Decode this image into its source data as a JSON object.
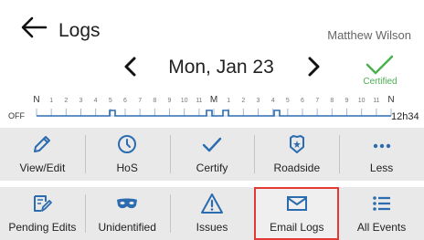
{
  "header": {
    "title": "Logs",
    "driver": "Matthew Wilson"
  },
  "date_nav": {
    "date": "Mon, Jan 23",
    "certified_label": "Certified"
  },
  "graph": {
    "hour_labels": [
      "N",
      "1",
      "2",
      "3",
      "4",
      "5",
      "6",
      "7",
      "8",
      "9",
      "10",
      "11",
      "M",
      "1",
      "2",
      "3",
      "4",
      "5",
      "6",
      "7",
      "8",
      "9",
      "10",
      "11",
      "N"
    ],
    "status_label": "OFF",
    "total": "12h34"
  },
  "actions_row1": [
    {
      "label": "View/Edit",
      "icon": "pencil-icon"
    },
    {
      "label": "HoS",
      "icon": "clock-icon"
    },
    {
      "label": "Certify",
      "icon": "checkmark-icon"
    },
    {
      "label": "Roadside",
      "icon": "badge-icon"
    },
    {
      "label": "Less",
      "icon": "ellipsis-icon"
    }
  ],
  "actions_row2": [
    {
      "label": "Pending Edits",
      "icon": "edit-document-icon"
    },
    {
      "label": "Unidentified",
      "icon": "mask-icon"
    },
    {
      "label": "Issues",
      "icon": "warning-icon"
    },
    {
      "label": "Email Logs",
      "icon": "mail-icon"
    },
    {
      "label": "All Events",
      "icon": "list-icon"
    }
  ],
  "colors": {
    "accent": "#2b6cb0",
    "certified": "#4caf50",
    "highlight": "#e53935",
    "button_bg": "#e9e9e9"
  }
}
